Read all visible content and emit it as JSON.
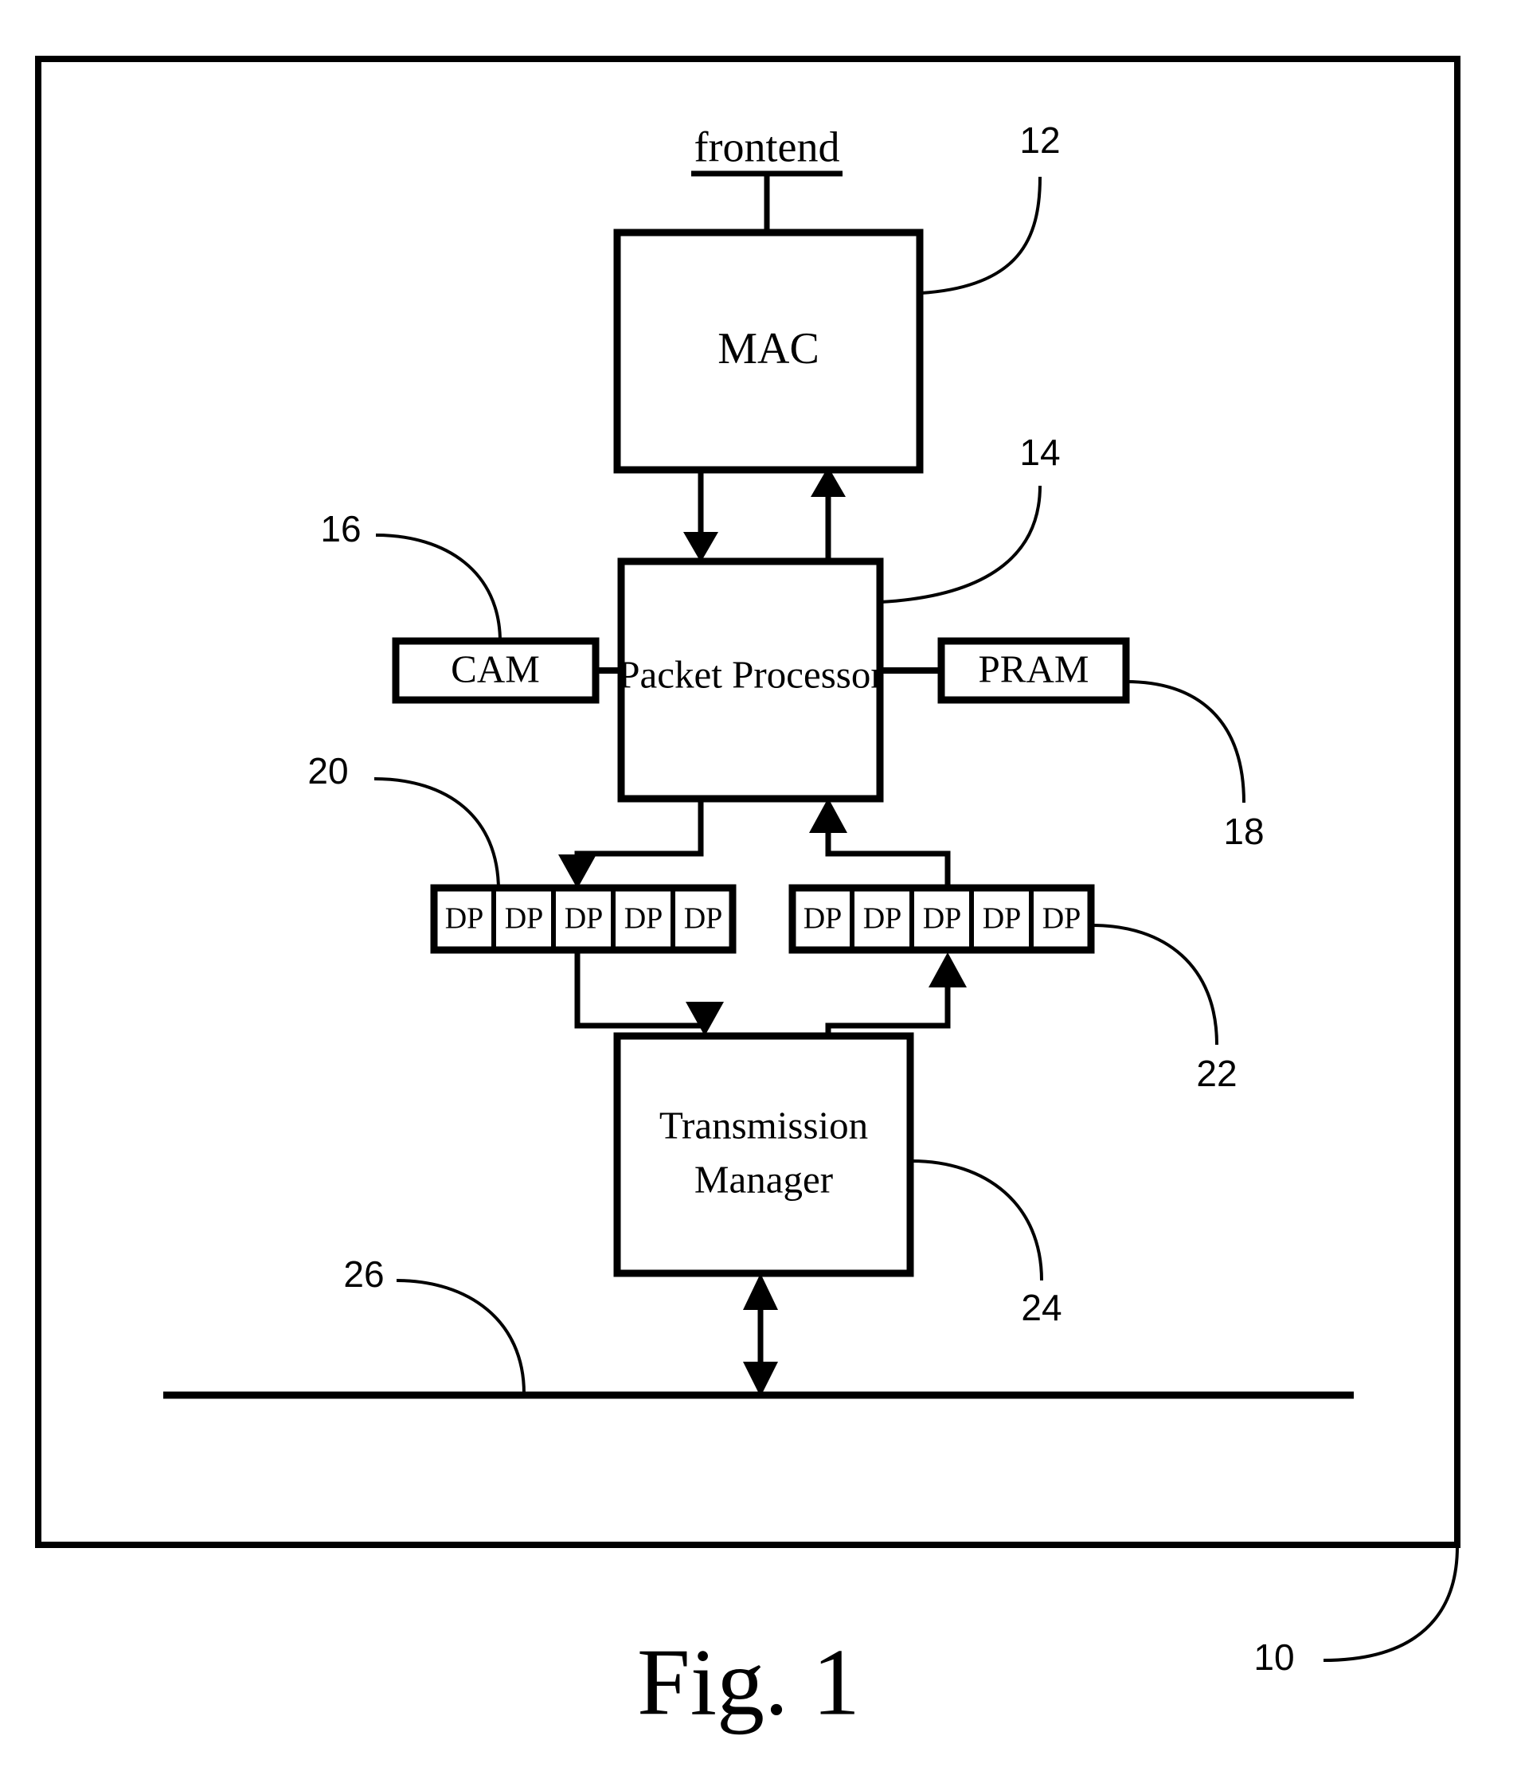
{
  "figure": {
    "caption": "Fig. 1",
    "frame_ref": "10",
    "external_label": "frontend"
  },
  "blocks": [
    {
      "id": "mac",
      "label": "MAC",
      "ref": "12"
    },
    {
      "id": "pp",
      "label": "Packet Processor",
      "ref": "14"
    },
    {
      "id": "cam",
      "label": "CAM",
      "ref": "16"
    },
    {
      "id": "pram",
      "label": "PRAM",
      "ref": "18"
    },
    {
      "id": "tm",
      "label_line1": "Transmission",
      "label_line2": "Manager",
      "ref": "24"
    }
  ],
  "queues": [
    {
      "id": "ingress-queue",
      "ref": "20",
      "cells": [
        {
          "label": "DP"
        },
        {
          "label": "DP"
        },
        {
          "label": "DP"
        },
        {
          "label": "DP"
        },
        {
          "label": "DP"
        }
      ]
    },
    {
      "id": "egress-queue",
      "ref": "22",
      "cells": [
        {
          "label": "DP"
        },
        {
          "label": "DP"
        },
        {
          "label": "DP"
        },
        {
          "label": "DP"
        },
        {
          "label": "DP"
        }
      ]
    }
  ],
  "bus": {
    "id": "system-bus",
    "ref": "26"
  },
  "colors": {
    "ink": "#000000",
    "paper": "#ffffff"
  }
}
